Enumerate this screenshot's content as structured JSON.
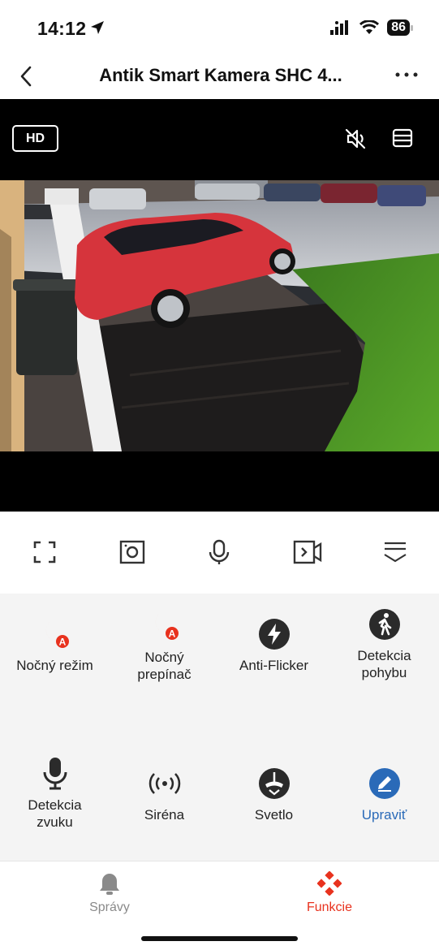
{
  "status": {
    "time": "14:12",
    "battery": "86"
  },
  "nav": {
    "title": "Antik Smart Kamera SHC 4..."
  },
  "video": {
    "quality": "HD"
  },
  "features": [
    {
      "label": "Nočný režim",
      "icon": "night-mode-auto-icon"
    },
    {
      "label": "Nočný prepínač",
      "icon": "night-switch-auto-icon"
    },
    {
      "label": "Anti-Flicker",
      "icon": "flash-icon"
    },
    {
      "label": "Detekcia pohybu",
      "icon": "walking-person-icon"
    },
    {
      "label": "Detekcia zvuku",
      "icon": "microphone-icon"
    },
    {
      "label": "Siréna",
      "icon": "siren-icon"
    },
    {
      "label": "Svetlo",
      "icon": "light-icon"
    },
    {
      "label": "Upraviť",
      "icon": "edit-pencil-icon"
    }
  ],
  "tabs": {
    "messages": "Správy",
    "functions": "Funkcie"
  },
  "colors": {
    "accent": "#e8321e",
    "edit_blue": "#2a6ab8",
    "icon_dark": "#222222"
  }
}
